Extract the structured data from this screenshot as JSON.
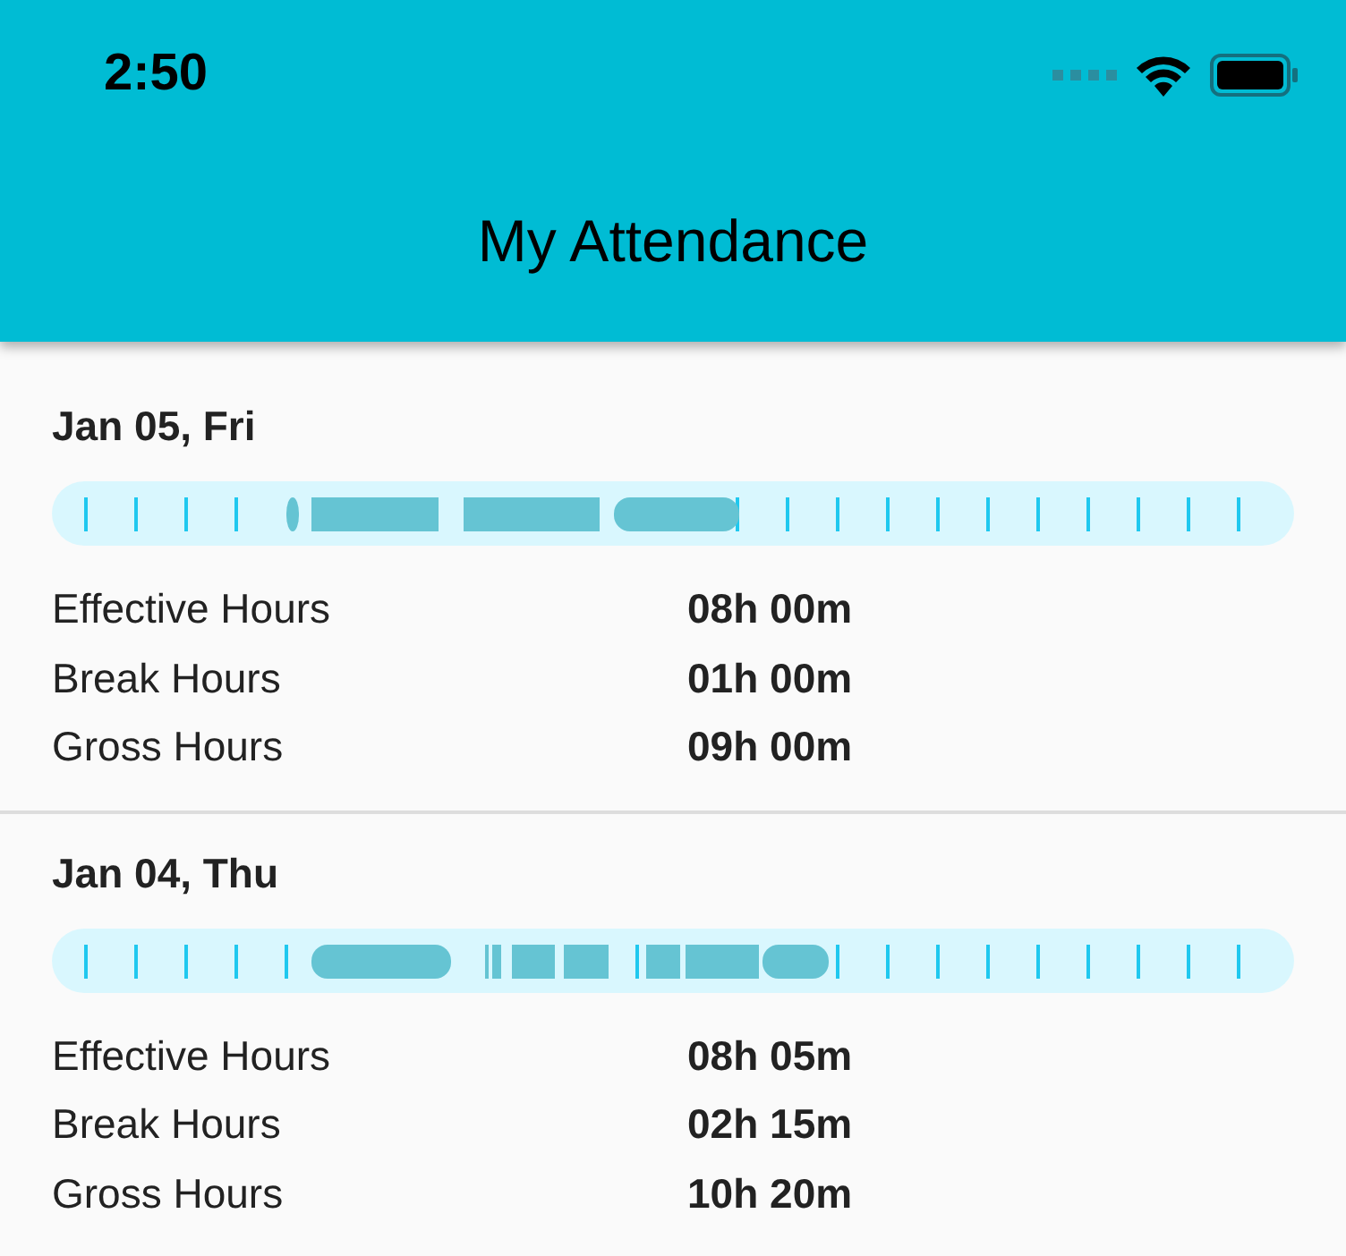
{
  "status_bar": {
    "time": "2:50"
  },
  "app_bar": {
    "title": "My Attendance"
  },
  "days": [
    {
      "date": "Jan 05, Fri",
      "stats": [
        {
          "label": "Effective Hours",
          "value": "08h 00m"
        },
        {
          "label": "Break Hours",
          "value": "01h 00m"
        },
        {
          "label": "Gross Hours",
          "value": "09h 00m"
        }
      ]
    },
    {
      "date": "Jan 04, Thu",
      "stats": [
        {
          "label": "Effective Hours",
          "value": "08h 05m"
        },
        {
          "label": "Break Hours",
          "value": "02h 15m"
        },
        {
          "label": "Gross Hours",
          "value": "10h 20m"
        }
      ]
    }
  ]
}
